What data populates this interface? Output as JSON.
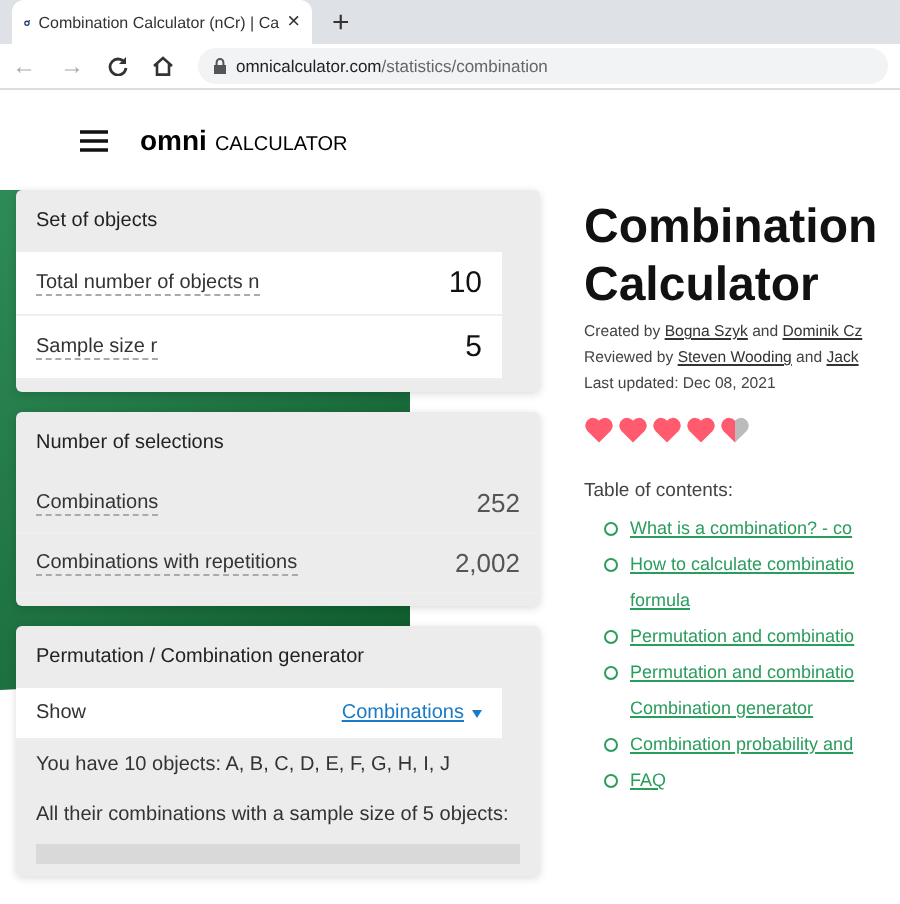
{
  "browser": {
    "back": "←",
    "forward": "→",
    "tab_title": "Combination Calculator (nCr) | Ca",
    "new_tab": "+",
    "close": "×",
    "url_host": "omnicalculator.com",
    "url_path": "/statistics/combination"
  },
  "header": {
    "logo_mark": "omni",
    "logo_text": "CALCULATOR"
  },
  "cards": [
    {
      "title": "Set of objects",
      "rows": [
        {
          "kind": "input",
          "label": "Total number of objects n",
          "value": "10"
        },
        {
          "kind": "input",
          "label": "Sample size r",
          "value": "5"
        }
      ]
    },
    {
      "title": "Number of selections",
      "rows": [
        {
          "kind": "output",
          "label": "Combinations",
          "value": "252"
        },
        {
          "kind": "output",
          "label": "Combinations with repetitions",
          "value": "2,002"
        }
      ]
    },
    {
      "title": "Permutation / Combination generator",
      "rows": [
        {
          "kind": "select",
          "label": "Show",
          "value": "Combinations"
        },
        {
          "kind": "text",
          "label": "You have 10 objects: A, B, C, D, E, F, G, H, I, J"
        },
        {
          "kind": "text",
          "label": "All their combinations with a sample size of 5 objects:"
        },
        {
          "kind": "result"
        }
      ]
    }
  ],
  "article": {
    "title_lines": [
      "Combination",
      "Calculator"
    ],
    "credits": [
      [
        {
          "kind": "text",
          "text": "Created by "
        },
        {
          "kind": "link",
          "text": "Bogna Szyk"
        },
        {
          "kind": "text",
          "text": " and "
        },
        {
          "kind": "link",
          "text": "Dominik Cz"
        }
      ],
      [
        {
          "kind": "text",
          "text": "Reviewed by "
        },
        {
          "kind": "link",
          "text": "Steven Wooding"
        },
        {
          "kind": "text",
          "text": " and "
        },
        {
          "kind": "link",
          "text": "Jack"
        }
      ],
      [
        {
          "kind": "text",
          "text": "Last updated: Dec 08, 2021"
        }
      ]
    ],
    "stars": 4.5,
    "toc_title": "Table of contents:",
    "toc": [
      {
        "lines": [
          "What is a combination? - co"
        ]
      },
      {
        "lines": [
          "How to calculate combinatio",
          "formula"
        ]
      },
      {
        "lines": [
          "Permutation and combinatio"
        ]
      },
      {
        "lines": [
          "Permutation and combinatio",
          "Combination generator"
        ]
      },
      {
        "lines": [
          "Combination probability and"
        ]
      },
      {
        "lines": [
          "FAQ"
        ]
      }
    ]
  }
}
